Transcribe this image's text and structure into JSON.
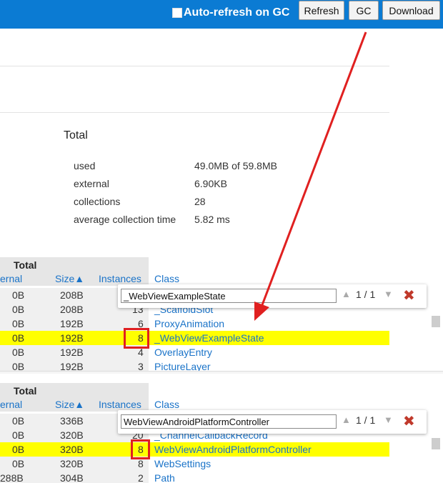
{
  "toolbar": {
    "auto_refresh_label": "Auto-refresh on GC",
    "refresh_label": "Refresh",
    "gc_label": "GC",
    "download_label": "Download"
  },
  "memory": {
    "heading": "Total",
    "rows": [
      {
        "label": "used",
        "value": "49.0MB of 59.8MB"
      },
      {
        "label": "external",
        "value": "6.90KB"
      },
      {
        "label": "collections",
        "value": "28"
      },
      {
        "label": "average collection time",
        "value": "5.82 ms"
      }
    ]
  },
  "table1": {
    "total_label": "Total",
    "col_external": "ernal",
    "col_size": "Size▲",
    "col_instances": "Instances",
    "col_class": "Class",
    "search": {
      "value": "_WebViewExampleState",
      "count": "1 / 1",
      "up_icon": "▲",
      "down_icon": "▼",
      "close_icon": "✖"
    },
    "rows": [
      {
        "ext": "0B",
        "size": "208B",
        "inst": "",
        "cls": ""
      },
      {
        "ext": "0B",
        "size": "208B",
        "inst": "13",
        "cls": "_ScaffoldSlot"
      },
      {
        "ext": "0B",
        "size": "192B",
        "inst": "6",
        "cls": "ProxyAnimation"
      },
      {
        "ext": "0B",
        "size": "192B",
        "inst": "8",
        "cls": "_WebViewExampleState",
        "highlight": true
      },
      {
        "ext": "0B",
        "size": "192B",
        "inst": "4",
        "cls": "OverlayEntry"
      },
      {
        "ext": "0B",
        "size": "192B",
        "inst": "3",
        "cls": "PictureLayer"
      }
    ]
  },
  "table2": {
    "total_label": "Total",
    "col_external": "ernal",
    "col_size": "Size▲",
    "col_instances": "Instances",
    "col_class": "Class",
    "search": {
      "value": "WebViewAndroidPlatformController",
      "count": "1 / 1",
      "up_icon": "▲",
      "down_icon": "▼",
      "close_icon": "✖"
    },
    "rows": [
      {
        "ext": "0B",
        "size": "336B",
        "inst": "",
        "cls": ""
      },
      {
        "ext": "0B",
        "size": "320B",
        "inst": "20",
        "cls": "_ChannelCallbackRecord"
      },
      {
        "ext": "0B",
        "size": "320B",
        "inst": "8",
        "cls": "WebViewAndroidPlatformController",
        "highlight": true
      },
      {
        "ext": "0B",
        "size": "320B",
        "inst": "8",
        "cls": "WebSettings"
      },
      {
        "ext": "288B",
        "size": "304B",
        "inst": "2",
        "cls": "Path"
      }
    ]
  },
  "colors": {
    "accent": "#0b7bd3",
    "highlight": "#ffff00",
    "link": "#1a73c8",
    "annotation": "#e02020"
  }
}
